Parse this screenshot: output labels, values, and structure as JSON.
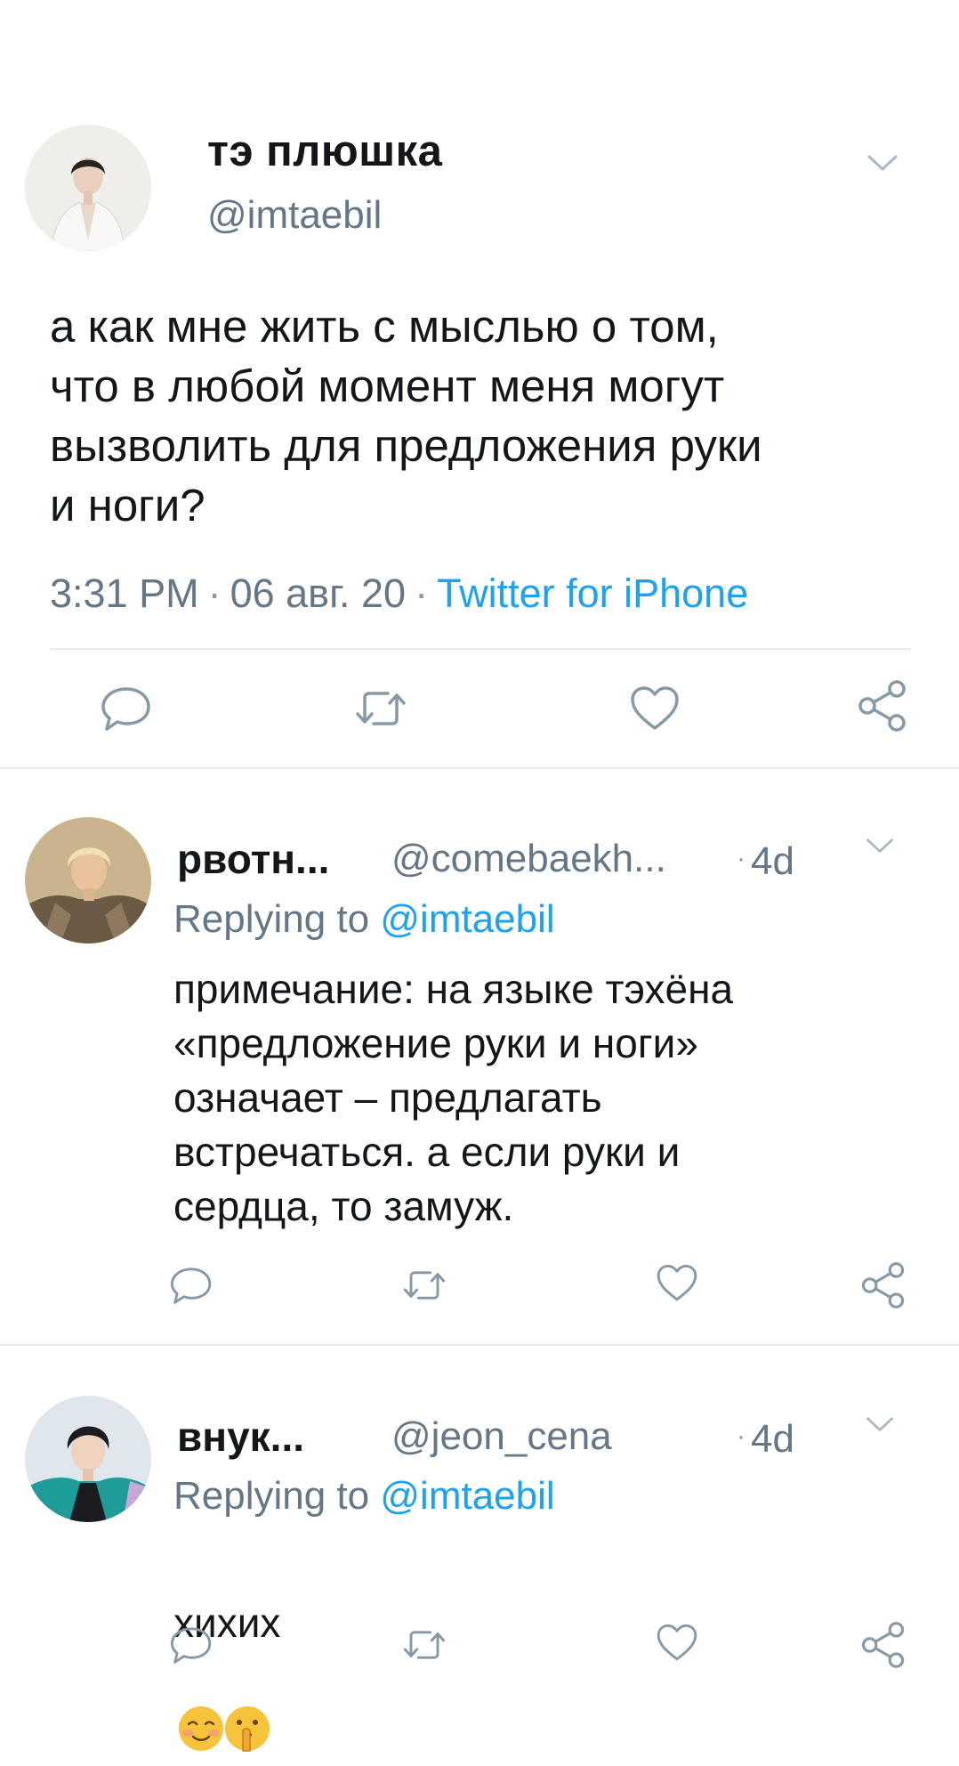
{
  "main_tweet": {
    "display_name": "тэ плюшка",
    "handle": "@imtaebil",
    "text": "а как мне жить с мыслью о том,\nчто в любой момент меня могут\nвызволить для предложения руки\nи ноги?",
    "time": "3:31 PM",
    "date": "06 авг. 20",
    "separator": "·",
    "source": "Twitter for iPhone",
    "avatar": "avatar-photo",
    "menu_icon": "chevron-down-icon",
    "actions": [
      "reply-icon",
      "retweet-icon",
      "like-icon",
      "share-icon"
    ]
  },
  "replies": [
    {
      "display_name": "рвотн...",
      "handle": "@comebaekh...",
      "time": "4d",
      "separator": "·",
      "replying_label": "Replying to",
      "replying_to": "@imtaebil",
      "text": "примечание: на языке тэхёна\n«предложение руки и ноги»\nозначает – предлагать\nвстречаться. а если руки и\nсердца, то замуж.",
      "avatar": "avatar-photo"
    },
    {
      "display_name": "внук...",
      "handle": "@jeon_cena",
      "time": "4d",
      "separator": "·",
      "replying_label": "Replying to",
      "replying_to": "@imtaebil",
      "text": "хихих",
      "emojis": [
        "smiling-face-emoji",
        "shushing-face-emoji"
      ],
      "avatar": "avatar-photo"
    }
  ],
  "colors": {
    "text": "#14171a",
    "secondary": "#657786",
    "link": "#1da1f2",
    "divider": "#e6ecf0",
    "icon": "#8899a6"
  }
}
